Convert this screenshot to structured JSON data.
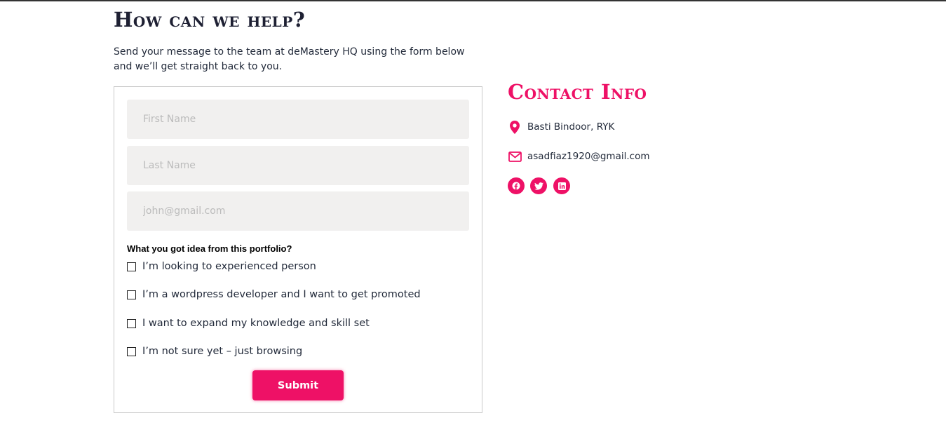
{
  "heading": "How can we help?",
  "intro": "Send your message to the team at deMastery HQ using the form below and we’ll get straight back to you.",
  "form": {
    "first_name_placeholder": "First Name",
    "last_name_placeholder": "Last Name",
    "email_placeholder": "john@gmail.com",
    "question": "What you got idea from this portfolio?",
    "options": [
      "I’m looking to experienced person",
      "I’m a wordpress developer and I want to get promoted",
      "I want to expand my knowledge and skill set",
      "I’m not sure yet – just browsing"
    ],
    "submit_label": "Submit"
  },
  "contact": {
    "title": "Contact Info",
    "address": "Basti Bindoor, RYK",
    "email": "asadfiaz1920@gmail.com",
    "address_icon": "map-marker-icon",
    "email_icon": "envelope-icon",
    "socials": [
      "facebook-icon",
      "twitter-icon",
      "linkedin-icon"
    ]
  },
  "colors": {
    "accent": "#ee1166",
    "heading": "#1e2033",
    "field_bg": "#f1f0ef"
  }
}
